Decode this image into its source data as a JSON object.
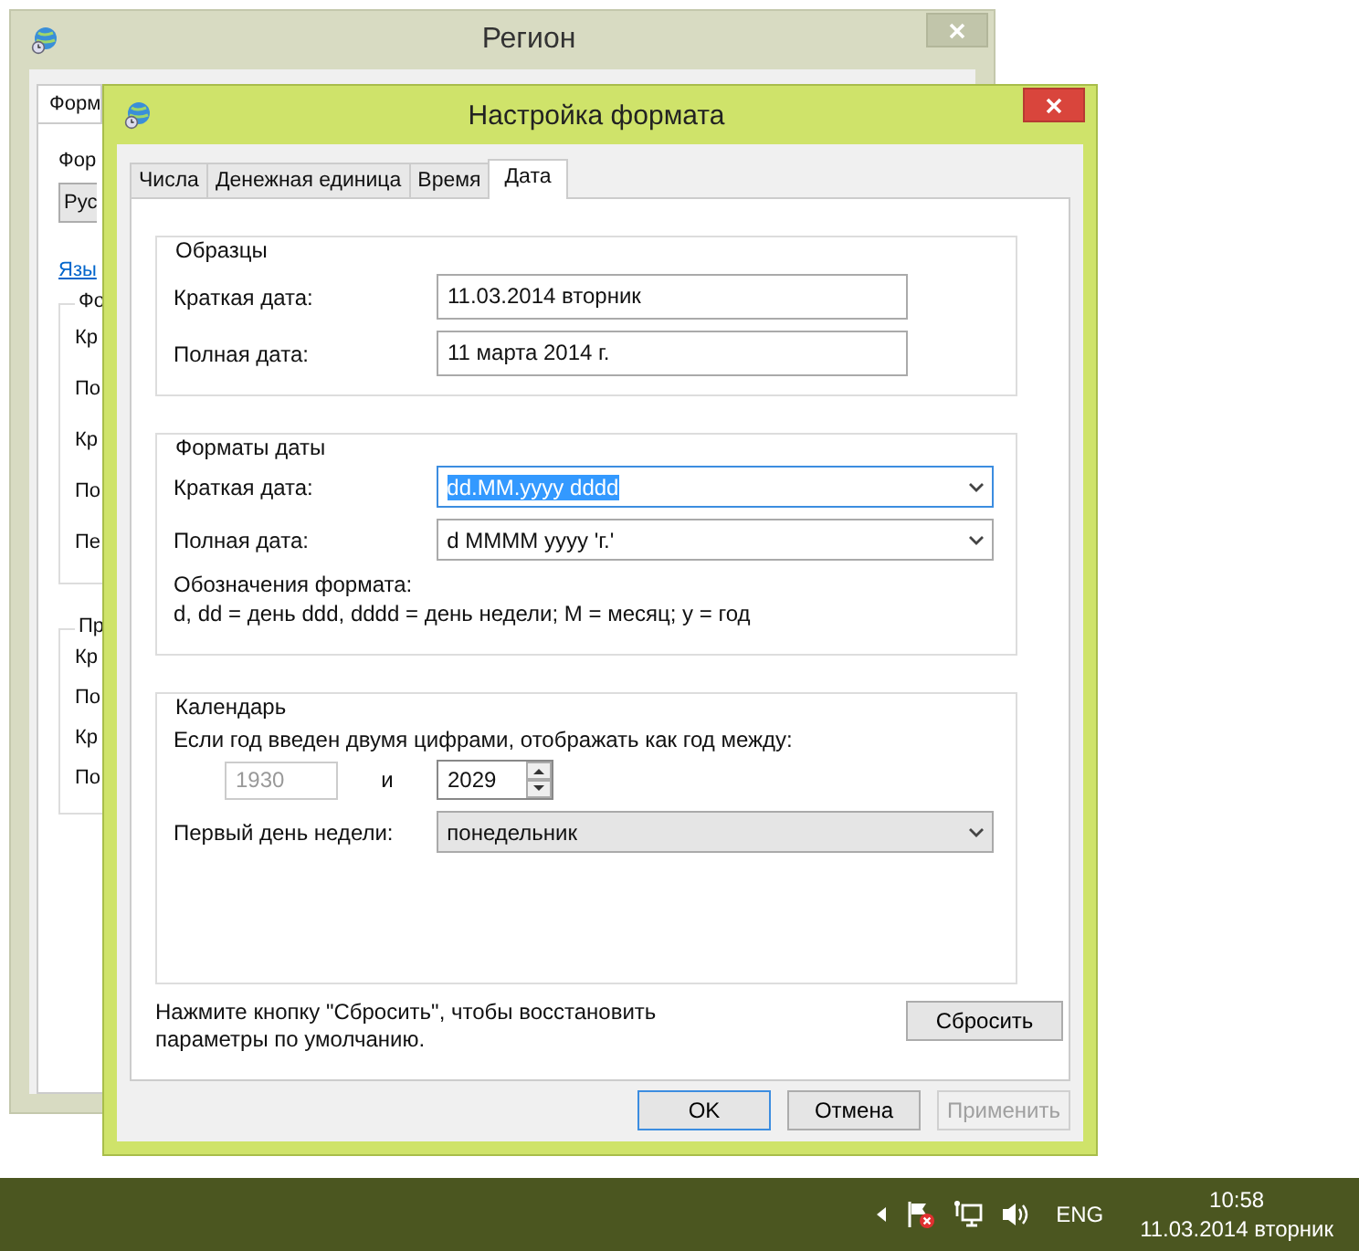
{
  "background_window": {
    "title": "Регион",
    "tab": "Форм",
    "items": [
      {
        "kind": "label",
        "text": "Фор"
      },
      {
        "kind": "combo",
        "text": "Рус"
      },
      {
        "kind": "link",
        "text": "Язы"
      },
      {
        "kind": "group",
        "text": "Фо",
        "children": [
          "Кр",
          "По",
          "Кр",
          "По",
          "Пе"
        ]
      },
      {
        "kind": "group",
        "text": "Пр",
        "children": [
          "Кр",
          "По",
          "Кр",
          "По"
        ]
      }
    ]
  },
  "dialog": {
    "title": "Настройка формата",
    "tabs": [
      {
        "label": "Числа",
        "selected": false
      },
      {
        "label": "Денежная единица",
        "selected": false
      },
      {
        "label": "Время",
        "selected": false
      },
      {
        "label": "Дата",
        "selected": true
      }
    ],
    "samples": {
      "title": "Образцы",
      "rows": [
        {
          "label": "Краткая дата:",
          "value": "11.03.2014 вторник"
        },
        {
          "label": "Полная дата:",
          "value": "11 марта 2014 г."
        }
      ]
    },
    "date_formats": {
      "title": "Форматы даты",
      "rows": [
        {
          "label": "Краткая дата:",
          "value": "dd.MM.yyyy dddd",
          "focused": true,
          "text_selected": true
        },
        {
          "label": "Полная дата:",
          "value": "d MMMM yyyy 'г.'",
          "focused": false,
          "text_selected": false
        }
      ],
      "notation_title": "Обозначения формата:",
      "notation": "d, dd = день  ddd, dddd = день недели; M = месяц; y = год"
    },
    "calendar": {
      "title": "Календарь",
      "two_digit_label": "Если год введен двумя цифрами, отображать как год между:",
      "from_year": {
        "value": "1930",
        "disabled": true
      },
      "and": "и",
      "to_year": {
        "value": "2029",
        "disabled": false
      },
      "first_day_label": "Первый день недели:",
      "first_day": "понедельник"
    },
    "reset_note": "Нажмите кнопку \"Сбросить\", чтобы восстановить параметры по умолчанию.",
    "reset_button": "Сбросить",
    "buttons": [
      {
        "label": "OK",
        "default": true,
        "disabled": false
      },
      {
        "label": "Отмена",
        "default": false,
        "disabled": false
      },
      {
        "label": "Применить",
        "default": false,
        "disabled": true
      }
    ]
  },
  "taskbar": {
    "language": "ENG",
    "time": "10:58",
    "date": "11.03.2014 вторник"
  }
}
